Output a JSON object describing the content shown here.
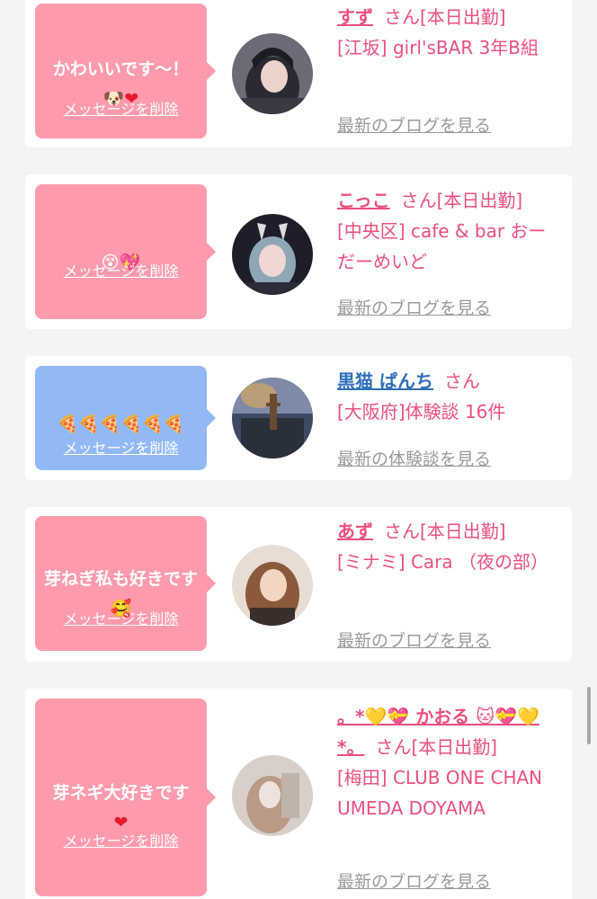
{
  "delete_label": "メッセージを削除",
  "entries": [
    {
      "message": "かわいいです〜！\n🐶",
      "heart": "❤",
      "name": "すず",
      "san": "さん",
      "status": "[本日出勤]",
      "shop": "[江坂] girl'sBAR 3年B組",
      "blog_link": "最新のブログを見る"
    },
    {
      "message": "😵💖",
      "name": "こっこ",
      "san": "さん",
      "status": "[本日出勤]",
      "shop": "[中央区] cafe & bar おーだーめいど",
      "blog_link": "最新のブログを見る"
    },
    {
      "message": "🍕🍕🍕🍕🍕🍕",
      "name": "黒猫 ぱんち",
      "san": "さん",
      "shop": "[大阪府]体験談 16件",
      "blog_link": "最新の体験談を見る"
    },
    {
      "message": "芽ねぎ私も好きです🥰",
      "name": "あず",
      "san": "さん",
      "status": "[本日出勤]",
      "shop": "[ミナミ] Cara （夜の部）",
      "blog_link": "最新のブログを見る"
    },
    {
      "message": "芽ネギ大好きです",
      "heart": "❤",
      "name": "。*💛💝 かおる 🐱💝💛*。",
      "san": "さん",
      "status": "[本日出勤]",
      "shop": "[梅田] CLUB ONE CHAN UMEDA DOYAMA",
      "blog_link": "最新のブログを見る"
    }
  ],
  "colors": {
    "pink_bubble": "#fd9bad",
    "blue_bubble": "#92b9f5",
    "accent_text": "#e9507d",
    "visitor_name": "#2f6fb8",
    "link_gray": "#9a9a9a"
  }
}
